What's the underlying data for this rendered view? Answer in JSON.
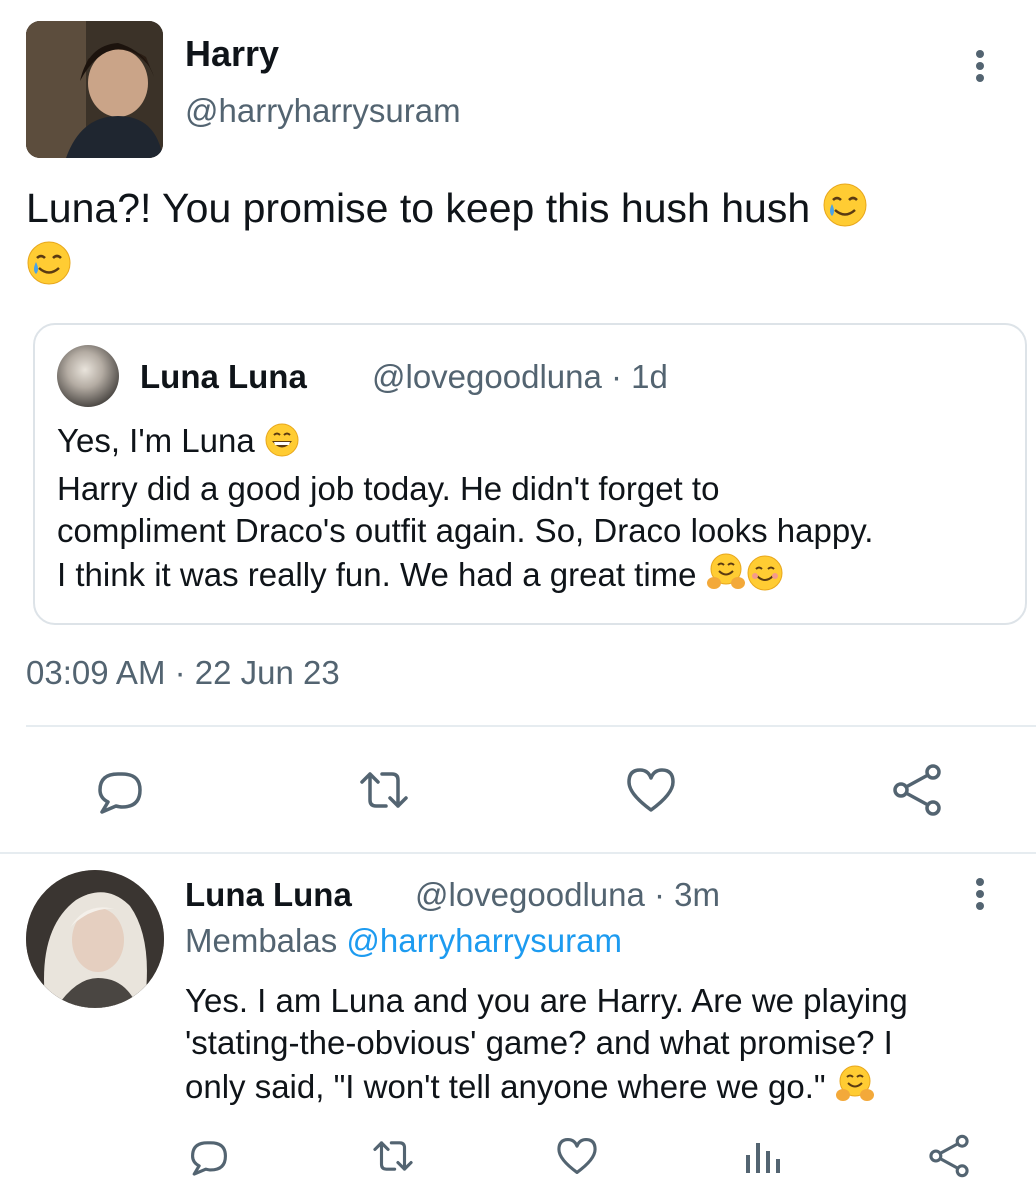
{
  "tweet": {
    "author_name": "Harry",
    "author_handle": "@harryharrysuram",
    "text": "Luna?! You promise to keep this hush hush",
    "timestamp": "03:09 AM · 22 Jun 23"
  },
  "quote": {
    "author_name": "Luna Luna",
    "meta": "@lovegoodluna · 1d",
    "line1": "Yes, I'm Luna",
    "line2": "Harry did a good job today. He didn't forget to",
    "line3": "compliment Draco's outfit again. So, Draco looks happy.",
    "line4": "I think it was really fun. We had a great time"
  },
  "reply": {
    "author_name": "Luna Luna",
    "meta": "@lovegoodluna · 3m",
    "replying_label": "Membalas",
    "replying_handle": "@harryharrysuram",
    "line1": "Yes. I am Luna and you are Harry. Are we playing",
    "line2": "'stating-the-obvious' game? and what promise? I",
    "line3": "only said, \"I won't tell anyone where we go.\""
  },
  "icons": {
    "more": "more-vertical-icon",
    "reply": "reply-icon",
    "retweet": "retweet-icon",
    "like": "heart-icon",
    "share": "share-icon",
    "views": "analytics-icon"
  },
  "colors": {
    "text": "#0f1419",
    "secondary": "#536471",
    "link": "#1d9bf0",
    "border": "#e6ecf0"
  }
}
